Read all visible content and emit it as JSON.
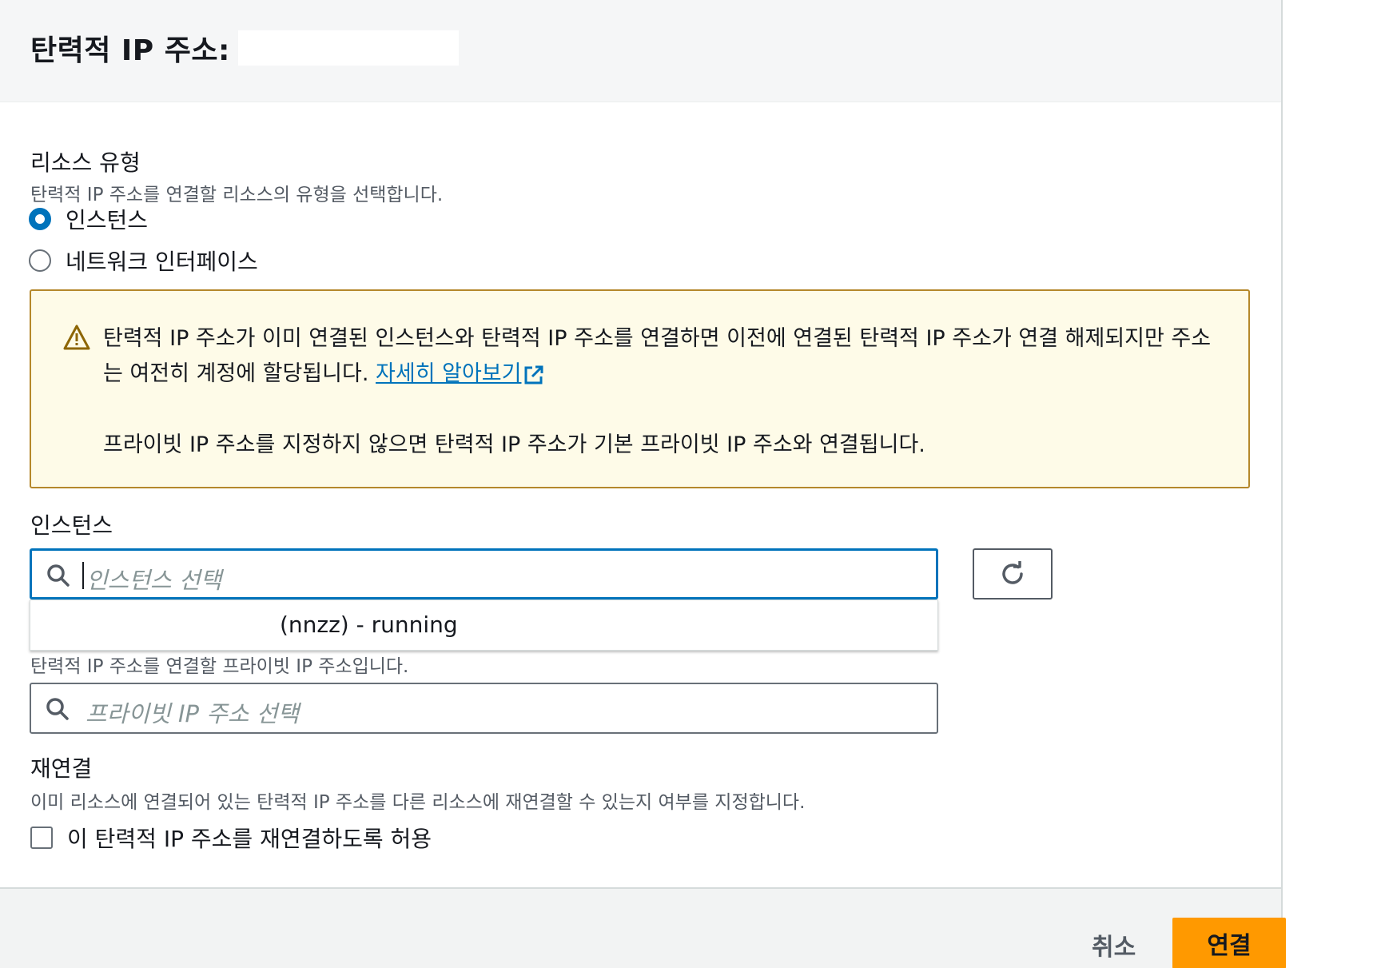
{
  "header": {
    "title": "탄력적 IP 주소:"
  },
  "resource_type": {
    "label": "리소스 유형",
    "description": "탄력적 IP 주소를 연결할 리소스의 유형을 선택합니다.",
    "options": [
      {
        "label": "인스턴스",
        "checked": true
      },
      {
        "label": "네트워크 인터페이스",
        "checked": false
      }
    ]
  },
  "alert": {
    "text": "탄력적 IP 주소가 이미 연결된 인스턴스와 탄력적 IP 주소를 연결하면 이전에 연결된 탄력적 IP 주소가 연결 해제되지만 주소는 여전히 계정에 할당됩니다.",
    "link_label": "자세히 알아보기",
    "text2": "프라이빗 IP 주소를 지정하지 않으면 탄력적 IP 주소가 기본 프라이빗 IP 주소와 연결됩니다.",
    "colors": {
      "background": "#fefbe8",
      "border": "#b5882b"
    }
  },
  "instance": {
    "label": "인스턴스",
    "placeholder": "인스턴스 선택",
    "dropdown_options": [
      "(nnzz) - running"
    ]
  },
  "private_ip": {
    "description": "탄력적 IP 주소를 연결할 프라이빗 IP 주소입니다.",
    "placeholder": "프라이빗 IP 주소 선택"
  },
  "reassociation": {
    "label": "재연결",
    "description": "이미 리소스에 연결되어 있는 탄력적 IP 주소를 다른 리소스에 재연결할 수 있는지 여부를 지정합니다.",
    "checkbox_label": "이 탄력적 IP 주소를 재연결하도록 허용",
    "checked": false
  },
  "footer": {
    "cancel_label": "취소",
    "submit_label": "연결",
    "colors": {
      "primary": "#ff9900",
      "link": "#0073bb"
    }
  }
}
